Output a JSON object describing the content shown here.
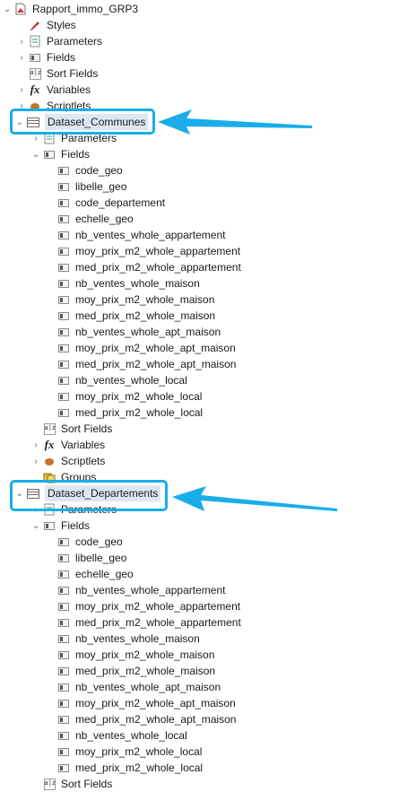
{
  "report": {
    "label": "Rapport_immo_GRP3"
  },
  "root_children": {
    "styles": "Styles",
    "parameters": "Parameters",
    "fields": "Fields",
    "sort_fields": "Sort Fields",
    "variables": "Variables",
    "scriptlets": "Scriptlets"
  },
  "dataset1": {
    "label": "Dataset_Communes",
    "parameters": "Parameters",
    "fields_label": "Fields",
    "fields": [
      "code_geo",
      "libelle_geo",
      "code_departement",
      "echelle_geo",
      "nb_ventes_whole_appartement",
      "moy_prix_m2_whole_appartement",
      "med_prix_m2_whole_appartement",
      "nb_ventes_whole_maison",
      "moy_prix_m2_whole_maison",
      "med_prix_m2_whole_maison",
      "nb_ventes_whole_apt_maison",
      "moy_prix_m2_whole_apt_maison",
      "med_prix_m2_whole_apt_maison",
      "nb_ventes_whole_local",
      "moy_prix_m2_whole_local",
      "med_prix_m2_whole_local"
    ],
    "sort_fields": "Sort Fields",
    "variables": "Variables",
    "scriptlets": "Scriptlets",
    "groups": "Groups"
  },
  "dataset2": {
    "label": "Dataset_Departements",
    "parameters": "Parameters",
    "fields_label": "Fields",
    "fields": [
      "code_geo",
      "libelle_geo",
      "echelle_geo",
      "nb_ventes_whole_appartement",
      "moy_prix_m2_whole_appartement",
      "med_prix_m2_whole_appartement",
      "nb_ventes_whole_maison",
      "moy_prix_m2_whole_maison",
      "med_prix_m2_whole_maison",
      "nb_ventes_whole_apt_maison",
      "moy_prix_m2_whole_apt_maison",
      "med_prix_m2_whole_apt_maison",
      "nb_ventes_whole_local",
      "moy_prix_m2_whole_local",
      "med_prix_m2_whole_local"
    ],
    "sort_fields": "Sort Fields"
  },
  "colors": {
    "highlight": "#19aeea",
    "selection": "#dde7f4"
  }
}
